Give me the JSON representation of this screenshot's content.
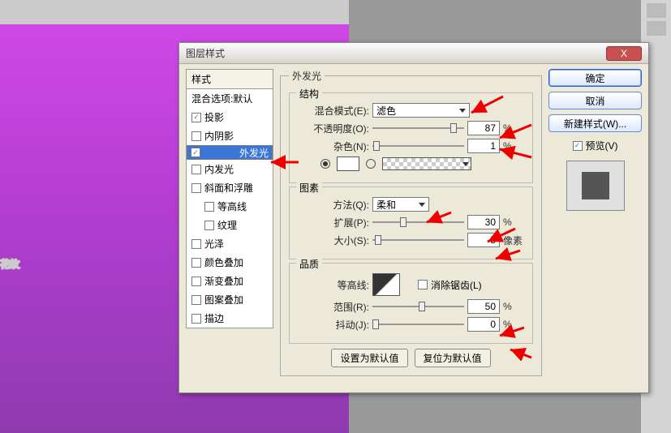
{
  "dialog": {
    "title": "图层样式",
    "close_x": "X"
  },
  "styles": {
    "header": "样式",
    "blend_default": "混合选项:默认",
    "items": [
      {
        "label": "投影",
        "checked": true
      },
      {
        "label": "内阴影",
        "checked": false
      },
      {
        "label": "外发光",
        "checked": true,
        "selected": true
      },
      {
        "label": "内发光",
        "checked": false
      },
      {
        "label": "斜面和浮雕",
        "checked": false
      },
      {
        "label": "等高线",
        "checked": false,
        "sub": true
      },
      {
        "label": "纹理",
        "checked": false,
        "sub": true
      },
      {
        "label": "光泽",
        "checked": false
      },
      {
        "label": "颜色叠加",
        "checked": false
      },
      {
        "label": "渐变叠加",
        "checked": false
      },
      {
        "label": "图案叠加",
        "checked": false
      },
      {
        "label": "描边",
        "checked": false
      }
    ]
  },
  "outer_glow": {
    "fieldset_label": "外发光",
    "structure": {
      "group_label": "结构",
      "blend_mode_label": "混合模式(E):",
      "blend_mode_value": "滤色",
      "opacity_label": "不透明度(O):",
      "opacity_value": "87",
      "opacity_unit": "%",
      "noise_label": "杂色(N):",
      "noise_value": "1",
      "noise_unit": "%"
    },
    "elements": {
      "group_label": "图素",
      "technique_label": "方法(Q):",
      "technique_value": "柔和",
      "spread_label": "扩展(P):",
      "spread_value": "30",
      "spread_unit": "%",
      "size_label": "大小(S):",
      "size_value": "5",
      "size_unit": "像素"
    },
    "quality": {
      "group_label": "品质",
      "contour_label": "等高线:",
      "anti_alias_label": "消除锯齿(L)",
      "range_label": "范围(R):",
      "range_value": "50",
      "range_unit": "%",
      "jitter_label": "抖动(J):",
      "jitter_value": "0",
      "jitter_unit": "%"
    },
    "buttons": {
      "set_default": "设置为默认值",
      "reset_default": "复位为默认值"
    }
  },
  "right": {
    "ok": "确定",
    "cancel": "取消",
    "new_style": "新建样式(W)...",
    "preview_label": "预览(V)",
    "preview_checked": true
  }
}
